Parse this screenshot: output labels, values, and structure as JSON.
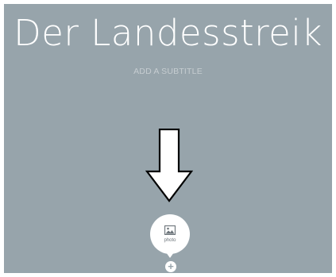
{
  "story": {
    "title": "Der Landesstreik",
    "subtitle_placeholder": "ADD A SUBTITLE"
  },
  "insert_menu": {
    "photo_label": "photo",
    "add_symbol": "+",
    "icons": {
      "photo": "image-icon",
      "add": "plus-icon"
    }
  },
  "annotation": {
    "icon": "down-arrow-icon"
  },
  "colors": {
    "background": "#97a4ab",
    "title": "#ffffff",
    "subtitle": "#c6cdd1",
    "bubble": "#ffffff",
    "arrow_fill": "#ffffff",
    "arrow_stroke": "#000000"
  }
}
